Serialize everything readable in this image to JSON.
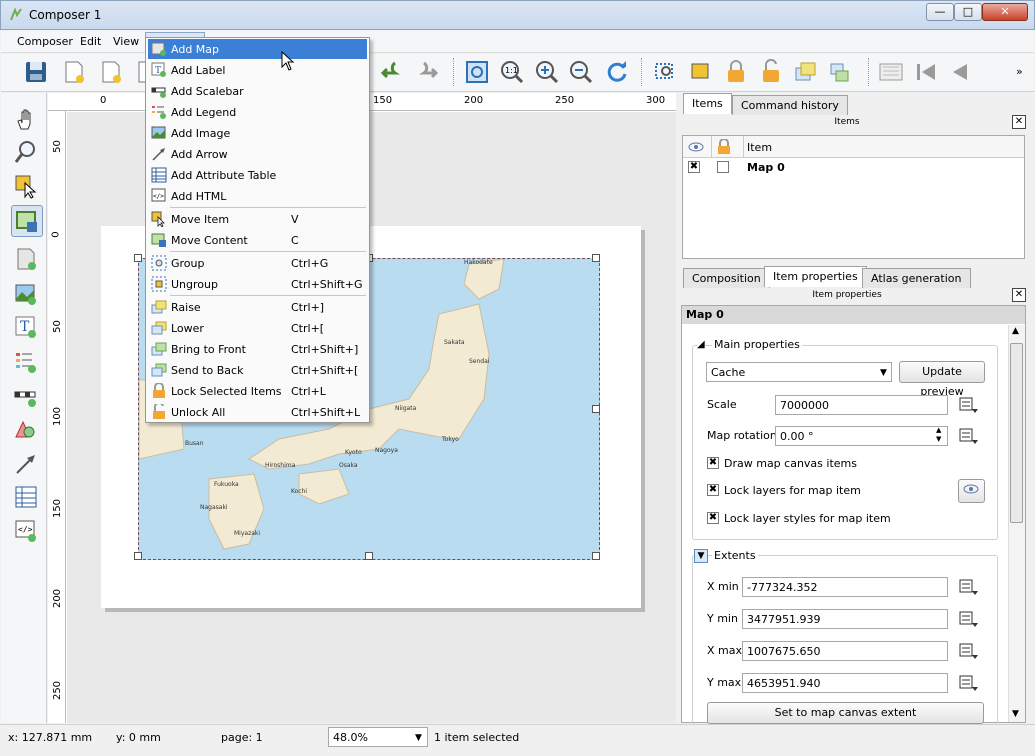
{
  "window": {
    "title": "Composer 1",
    "btn_min": "—",
    "btn_max": "□",
    "btn_close": "✕"
  },
  "menubar": {
    "items": [
      "Composer",
      "Edit",
      "View"
    ]
  },
  "dropdown": {
    "items": [
      {
        "label": "Add Map",
        "shortcut": ""
      },
      {
        "label": "Add Label",
        "shortcut": ""
      },
      {
        "label": "Add Scalebar",
        "shortcut": ""
      },
      {
        "label": "Add Legend",
        "shortcut": ""
      },
      {
        "label": "Add Image",
        "shortcut": ""
      },
      {
        "label": "Add Arrow",
        "shortcut": ""
      },
      {
        "label": "Add Attribute Table",
        "shortcut": ""
      },
      {
        "label": "Add HTML",
        "shortcut": ""
      },
      {
        "label": "Move Item",
        "shortcut": "V"
      },
      {
        "label": "Move Content",
        "shortcut": "C"
      },
      {
        "label": "Group",
        "shortcut": "Ctrl+G"
      },
      {
        "label": "Ungroup",
        "shortcut": "Ctrl+Shift+G"
      },
      {
        "label": "Raise",
        "shortcut": "Ctrl+]"
      },
      {
        "label": "Lower",
        "shortcut": "Ctrl+["
      },
      {
        "label": "Bring to Front",
        "shortcut": "Ctrl+Shift+]"
      },
      {
        "label": "Send to Back",
        "shortcut": "Ctrl+Shift+["
      },
      {
        "label": "Lock Selected Items",
        "shortcut": "Ctrl+L"
      },
      {
        "label": "Unlock All",
        "shortcut": "Ctrl+Shift+L"
      }
    ]
  },
  "ruler": {
    "top": [
      "0",
      "150",
      "200",
      "250",
      "300"
    ],
    "left": [
      "50",
      "0",
      "50",
      "100",
      "150",
      "200",
      "250"
    ]
  },
  "map": {
    "cities": [
      "Hakodate",
      "Sakata",
      "Sendai",
      "Niigata",
      "Tokyo",
      "Nagoya",
      "Kyoto",
      "Osaka",
      "Hiroshima",
      "Busan",
      "Fukuoka",
      "Kochi",
      "Nagasaki",
      "Miyazaki"
    ]
  },
  "panel": {
    "top_tabs": [
      "Items",
      "Command history"
    ],
    "items_title": "Items",
    "items_header": "Item",
    "items_row": "Map 0",
    "bottom_tabs": [
      "Composition",
      "Item properties",
      "Atlas generation"
    ],
    "props_title": "Item properties",
    "item_name": "Map 0",
    "main_props": "Main properties",
    "preview_mode": "Cache",
    "update_preview": "Update preview",
    "scale_label": "Scale",
    "scale_value": "7000000",
    "rotation_label": "Map rotation",
    "rotation_value": "0.00 °",
    "draw_canvas": "Draw map canvas items",
    "lock_layers": "Lock layers for map item",
    "lock_styles": "Lock layer styles for map item",
    "extents": "Extents",
    "xmin_label": "X min",
    "xmin": "-777324.352",
    "ymin_label": "Y min",
    "ymin": "3477951.939",
    "xmax_label": "X max",
    "xmax": "1007675.650",
    "ymax_label": "Y max",
    "ymax": "4653951.940",
    "set_extent": "Set to map canvas extent"
  },
  "status": {
    "x": "x: 127.871 mm",
    "y": "y: 0 mm",
    "page": "page: 1",
    "zoom": "48.0%",
    "selected": "1 item selected"
  }
}
